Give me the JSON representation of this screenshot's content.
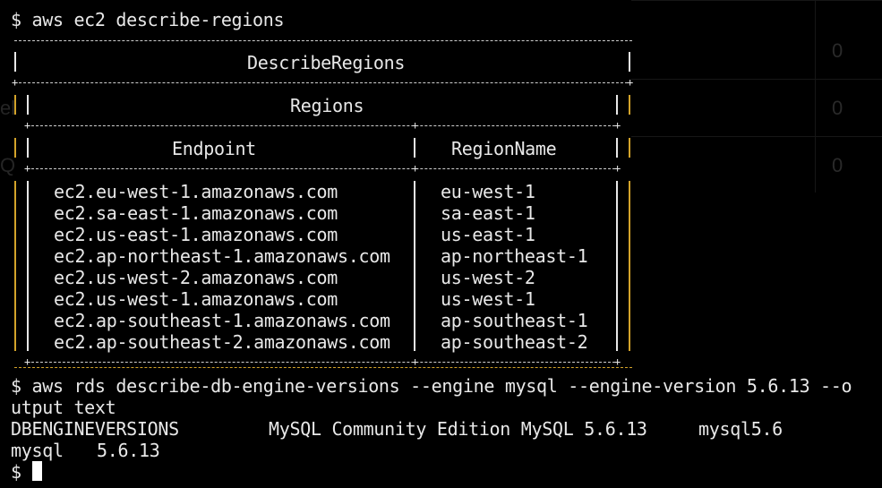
{
  "ghost": {
    "values": [
      "0",
      "0",
      "0"
    ],
    "left_fragments": [
      "el",
      "Q"
    ]
  },
  "commands": {
    "cmd1": "$ aws ec2 describe-regions",
    "cmd2": "$ aws rds describe-db-engine-versions --engine mysql --engine-version 5.6.13 --o",
    "cmd2_wrap": "utput text",
    "prompt": "$"
  },
  "table": {
    "title": "DescribeRegions",
    "subtitle": "Regions",
    "headers": {
      "endpoint": "Endpoint",
      "region": "RegionName"
    },
    "rows": [
      {
        "endpoint": "ec2.eu-west-1.amazonaws.com",
        "region": "eu-west-1"
      },
      {
        "endpoint": "ec2.sa-east-1.amazonaws.com",
        "region": "sa-east-1"
      },
      {
        "endpoint": "ec2.us-east-1.amazonaws.com",
        "region": "us-east-1"
      },
      {
        "endpoint": "ec2.ap-northeast-1.amazonaws.com",
        "region": "ap-northeast-1"
      },
      {
        "endpoint": "ec2.us-west-2.amazonaws.com",
        "region": "us-west-2"
      },
      {
        "endpoint": "ec2.us-west-1.amazonaws.com",
        "region": "us-west-1"
      },
      {
        "endpoint": "ec2.ap-southeast-1.amazonaws.com",
        "region": "ap-southeast-1"
      },
      {
        "endpoint": "ec2.ap-southeast-2.amazonaws.com",
        "region": "ap-southeast-2"
      }
    ]
  },
  "output": {
    "row1_col1": "DBENGINEVERSIONS",
    "row1_col2": "MySQL Community Edition MySQL 5.6.13",
    "row1_col3": "mysql5.6",
    "row2_col1": "mysql",
    "row2_col2": "5.6.13"
  },
  "colors": {
    "background": "#000000",
    "text": "#e8e8e8",
    "value_blue": "#6f9bd1",
    "border_yellow": "#d3a32a"
  }
}
